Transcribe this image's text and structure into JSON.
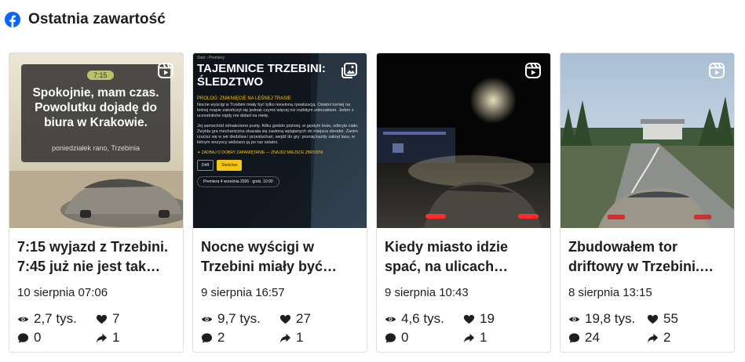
{
  "header": {
    "icon": "facebook-icon",
    "title": "Ostatnia zawartość"
  },
  "colors": {
    "facebook_blue": "#0866ff",
    "text": "#1c1e21",
    "accent_yellow": "#f5c518"
  },
  "cards": [
    {
      "type_icon": "reels-icon",
      "thumb_text": {
        "pill": "7:15",
        "main": "Spokojnie, mam czas. Powolutku dojadę do biura w Krakowie.",
        "sub": "poniedziałek rano, Trzebinia"
      },
      "title": "7:15 wyjazd z Trzebini. 7:45 już nie jest tak…",
      "date": "10 sierpnia 07:06",
      "views": "2,7 tys.",
      "likes": "7",
      "comments": "0",
      "shares": "1"
    },
    {
      "type_icon": "photo-icon",
      "thumb_text": {
        "crumb": "Start  ›  Premiery",
        "heading": "TAJEMNICE TRZEBINI: ŚLEDZTWO",
        "section": "PROLOG: ZNIKNIĘCIE NA LEŚNEJ TRASIE",
        "p1": "Nocne wyścigi w Trzebini miały być tylko niewinną rywalizacją. Ostatni turniej na leśnej mapie zakończył się jednak czymś więcej niż rozbitym zderzakiem. Jeden z uczestników nigdy nie dotarł na metę.",
        "p2": "Jej samochód odnaleziono pusty. Kilku godzin później, w gęstym lesie, odkryto ciało. Zwykła gra mechaniczna okazała się zasłoną wplątanych do miejsca zbrodni. Zanim rzucisz się w wir śledztwa i przesłuchań, wejdź do gry: poznaj każdy zakręt lasu, w którym wszyscy widziano ją po raz ostatni.",
        "warning": "✦ ZADBAJ O DOBRY ZAPAMIĘTANIE — ZNAJDZ MIEJSCE ZBRODNI",
        "tags": [
          "Drift",
          "Śledztwo"
        ],
        "premiere": "Premiera 4 września 2026 · godz. 10:00"
      },
      "title": "Nocne wyścigi w Trzebini miały być…",
      "date": "9 sierpnia 16:57",
      "views": "9,7 tys.",
      "likes": "27",
      "comments": "2",
      "shares": "1"
    },
    {
      "type_icon": "reels-icon",
      "title": "Kiedy miasto idzie spać, na ulicach…",
      "date": "9 sierpnia 10:43",
      "views": "4,6 tys.",
      "likes": "19",
      "comments": "0",
      "shares": "1"
    },
    {
      "type_icon": "reels-icon",
      "title": "Zbudowałem tor driftowy w Trzebini.…",
      "date": "8 sierpnia 13:15",
      "views": "19,8 tys.",
      "likes": "55",
      "comments": "24",
      "shares": "2"
    }
  ]
}
